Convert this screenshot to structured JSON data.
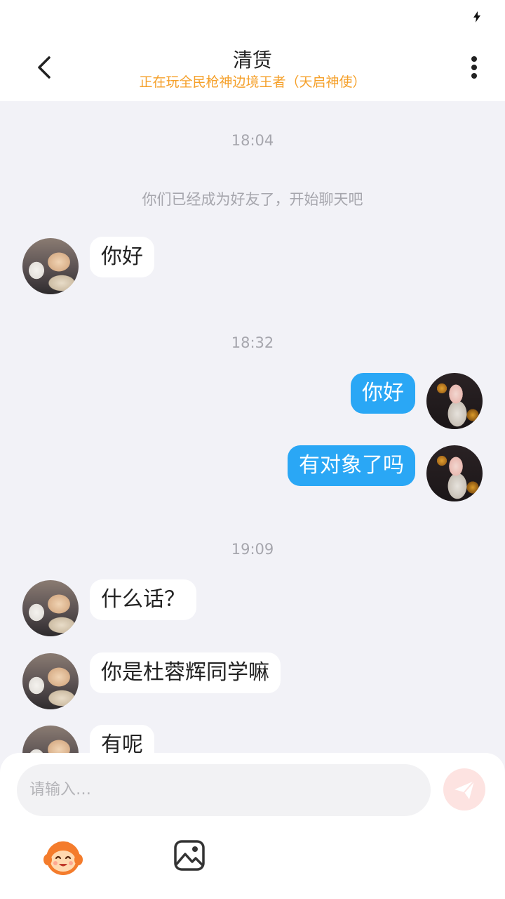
{
  "header": {
    "title": "清赁",
    "subtitle": "正在玩全民枪神边境王者（天启神使）"
  },
  "chat": {
    "timestamps": [
      "18:04",
      "18:32",
      "19:09"
    ],
    "system_message": "你们已经成为好友了，开始聊天吧",
    "messages": [
      {
        "side": "left",
        "text": "你好"
      },
      {
        "side": "right",
        "text": "你好"
      },
      {
        "side": "right",
        "text": "有对象了吗"
      },
      {
        "side": "left",
        "text": "什么话？"
      },
      {
        "side": "left",
        "text": "你是杜蓉辉同学嘛"
      },
      {
        "side": "left",
        "text": "有呢"
      }
    ]
  },
  "input": {
    "placeholder": "请输入…"
  },
  "icons": {
    "back": "chevron-left-icon",
    "more": "more-vertical-icon",
    "send": "send-icon",
    "emoji": "emoji-mascot-icon",
    "image": "image-icon",
    "status": "charging-bolt-icon"
  },
  "colors": {
    "accent_blue": "#2aa7f5",
    "subtitle_orange": "#f5a02a",
    "send_button": "#fde3e1",
    "chat_background": "#f2f2f7"
  }
}
